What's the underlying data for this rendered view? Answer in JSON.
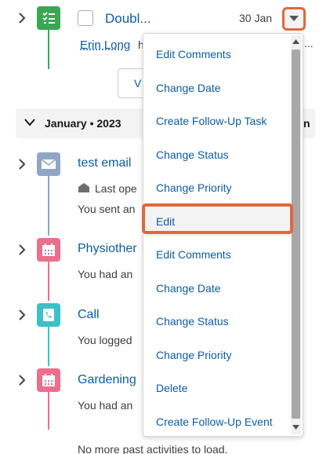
{
  "top_item": {
    "title": "Doubl...",
    "date": "30 Jan",
    "assignee": "Erin Long",
    "assignee_suffix": "h",
    "ellipsis": "...",
    "view_button": "V"
  },
  "section": {
    "label": "January • 2023",
    "trailing": "n"
  },
  "activities": [
    {
      "title": "test email",
      "line1": "Last ope",
      "line2": "You sent an",
      "icon": "envelope-icon",
      "color": "#8fa7c4"
    },
    {
      "title": "Physiother",
      "line1": "You had an",
      "icon": "calendar-icon",
      "color": "#eb6e8d"
    },
    {
      "title": "Call",
      "line1": "You logged",
      "icon": "phone-icon",
      "color": "#3bc1c9"
    },
    {
      "title": "Gardening",
      "line1": "You had an",
      "icon": "calendar-icon",
      "color": "#eb6e8d"
    }
  ],
  "footer": "No more past activities to load.",
  "menu": {
    "items": [
      "Edit Comments",
      "Change Date",
      "Create Follow-Up Task",
      "Change Status",
      "Change Priority",
      "Edit",
      "Edit Comments",
      "Change Date",
      "Change Status",
      "Change Priority",
      "Delete",
      "Create Follow-Up Event"
    ],
    "highlighted_index": 5
  },
  "colors": {
    "task_green": "#3ba755",
    "highlight_orange": "#e0683a",
    "link_blue": "#0b5cab"
  }
}
